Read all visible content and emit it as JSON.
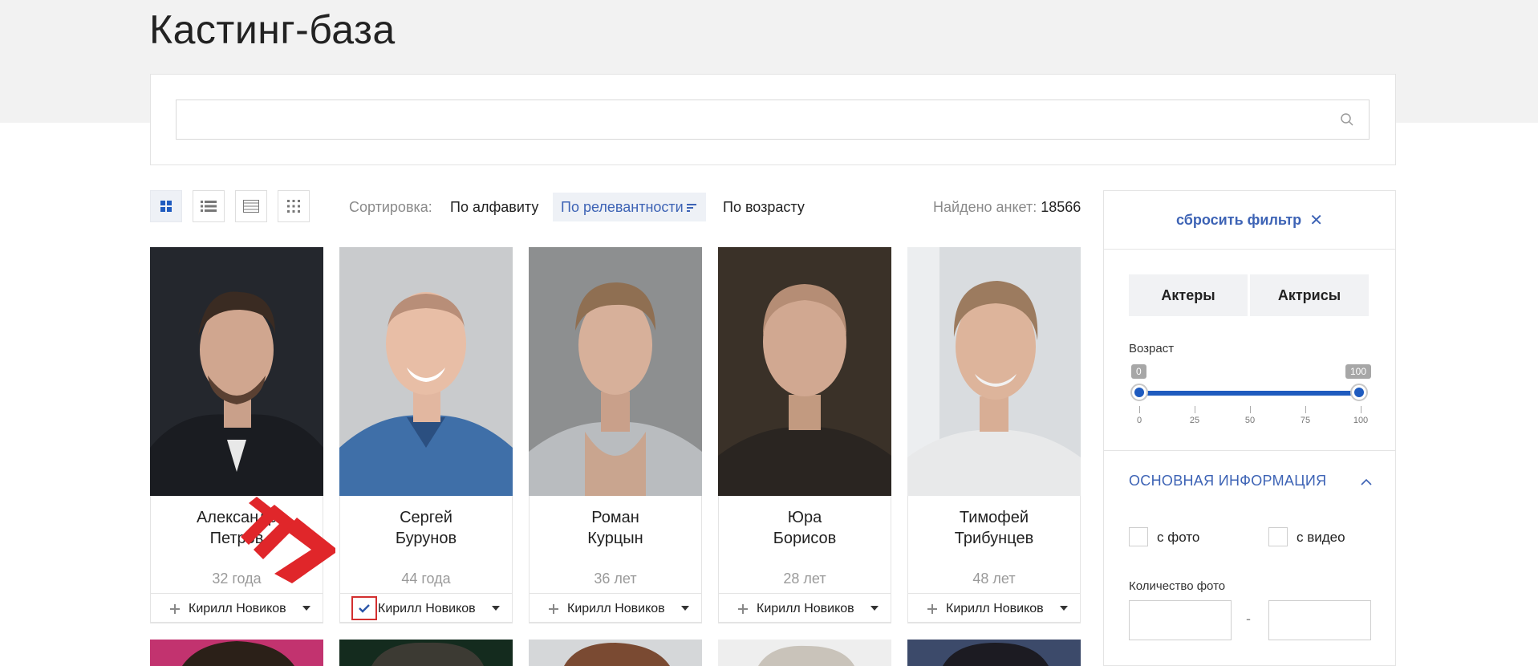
{
  "header": {
    "title": "Кастинг-база"
  },
  "search": {
    "value": "",
    "placeholder": ""
  },
  "toolbar": {
    "view_modes": [
      "grid-large",
      "list",
      "table",
      "grid-small"
    ],
    "active_view": "grid-large",
    "sort_label": "Сортировка:",
    "sort_options": [
      "По алфавиту",
      "По релевантности",
      "По возрасту"
    ],
    "active_sort": "По релевантности",
    "found_label": "Найдено анкет:",
    "found_count": "18566"
  },
  "cards": [
    {
      "first_name": "Александр",
      "last_name": "Петров",
      "age": "32 года",
      "agent": "Кирилл Новиков",
      "selected": false
    },
    {
      "first_name": "Сергей",
      "last_name": "Бурунов",
      "age": "44 года",
      "agent": "Кирилл Новиков",
      "selected": true
    },
    {
      "first_name": "Роман",
      "last_name": "Курцын",
      "age": "36 лет",
      "agent": "Кирилл Новиков",
      "selected": false
    },
    {
      "first_name": "Юра",
      "last_name": "Борисов",
      "age": "28 лет",
      "agent": "Кирилл Новиков",
      "selected": false
    },
    {
      "first_name": "Тимофей",
      "last_name": "Трибунцев",
      "age": "48 лет",
      "agent": "Кирилл Новиков",
      "selected": false
    }
  ],
  "sidebar": {
    "reset_label": "сбросить фильтр",
    "gender_tabs": [
      "Актеры",
      "Актрисы"
    ],
    "age": {
      "label": "Возраст",
      "min_badge": "0",
      "max_badge": "100",
      "ticks": [
        "0",
        "25",
        "50",
        "75",
        "100"
      ],
      "selected_min": 0,
      "selected_max": 100
    },
    "section_title": "ОСНОВНАЯ ИНФОРМАЦИЯ",
    "checkbox_photo": "с фото",
    "checkbox_video": "с видео",
    "photo_count_label": "Количество фото",
    "photo_count_from": "",
    "photo_count_to": "",
    "range_dash": "-"
  },
  "colors": {
    "accent": "#3d63b5",
    "slider": "#1f5bbf",
    "top_band": "#f2f2f2",
    "highlight": "#d32f2f",
    "arrow": "#e0262a"
  }
}
